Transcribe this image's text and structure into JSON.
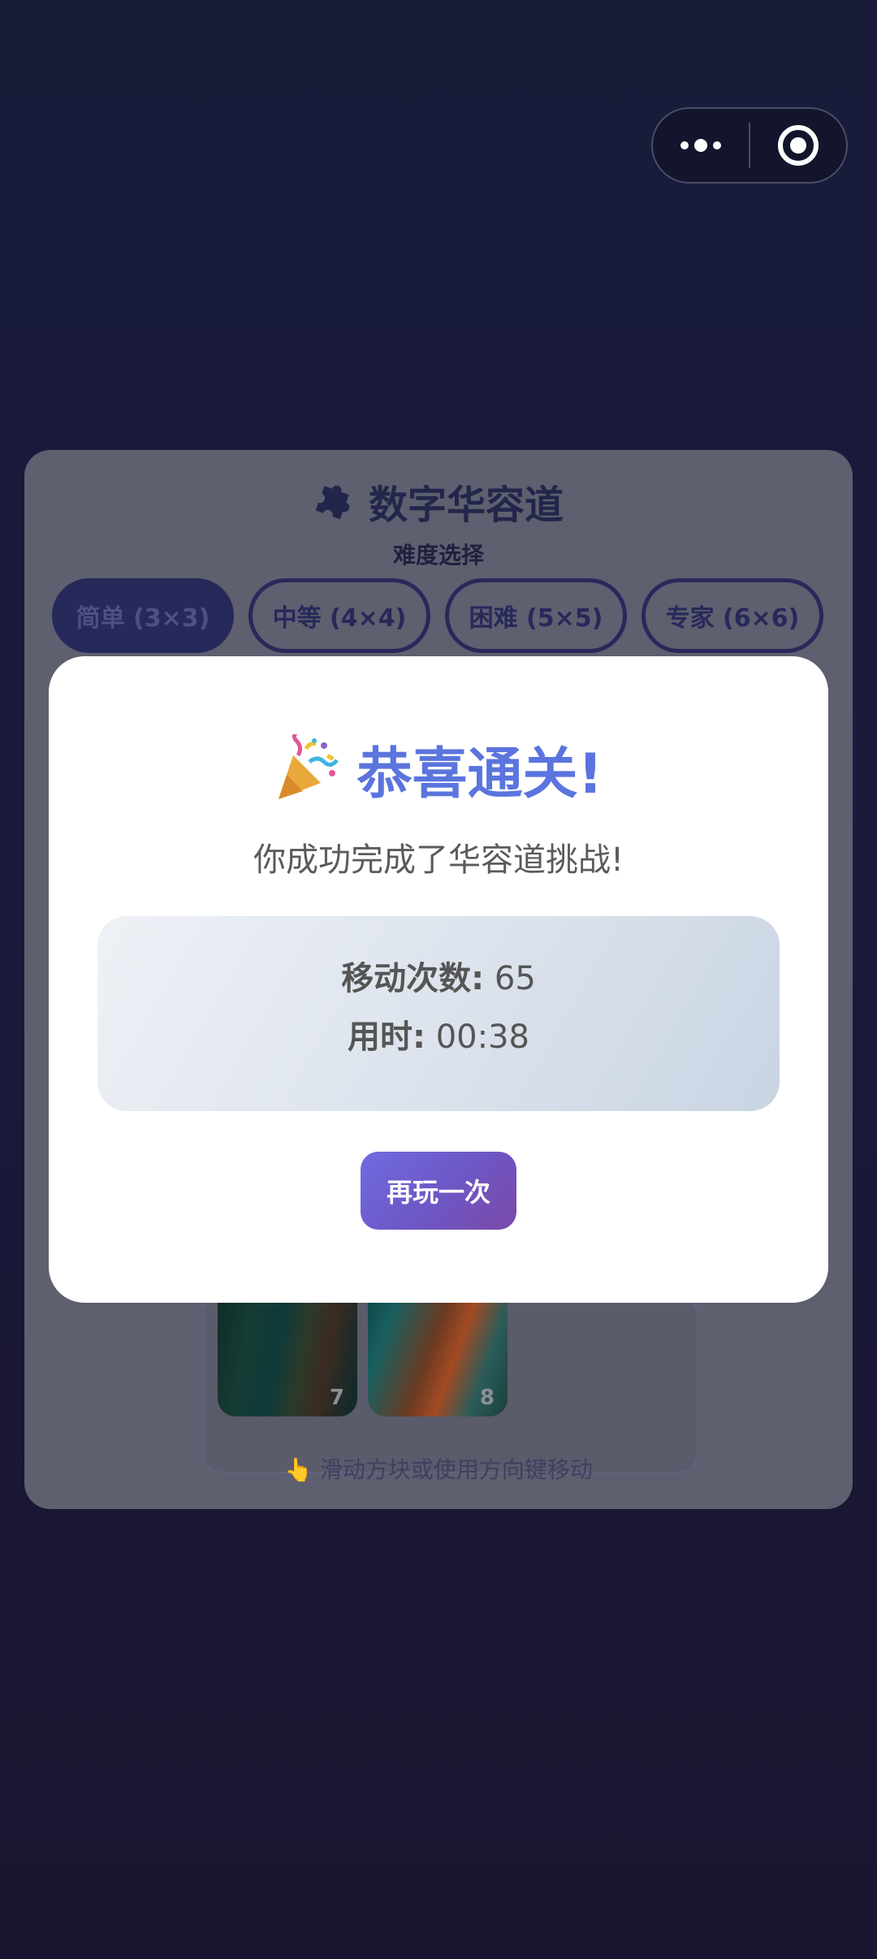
{
  "capsule": {
    "more_icon": "more-dots-icon",
    "close_icon": "target-circle-icon"
  },
  "game": {
    "title": "数字华容道",
    "title_icon": "puzzle-piece-icon",
    "difficulty_label": "难度选择",
    "difficulties": [
      {
        "label": "简单 (3×3)",
        "selected": true
      },
      {
        "label": "中等 (4×4)",
        "selected": false
      },
      {
        "label": "困难 (5×5)",
        "selected": false
      },
      {
        "label": "专家 (6×6)",
        "selected": false
      }
    ],
    "tiles": [
      {
        "number": "7"
      },
      {
        "number": "8"
      }
    ],
    "hint": "👆 滑动方块或使用方向键移动"
  },
  "modal": {
    "title": "恭喜通关!",
    "title_icon": "party-popper-icon",
    "subtitle": "你成功完成了华容道挑战!",
    "moves_label": "移动次数:",
    "moves_value": "65",
    "time_label": "用时:",
    "time_value": "00:38",
    "replay_label": "再玩一次"
  },
  "colors": {
    "accent": "#5b74de",
    "button_start": "#6f6be0",
    "button_end": "#7a4aa8",
    "background": "#1b1a3d"
  }
}
